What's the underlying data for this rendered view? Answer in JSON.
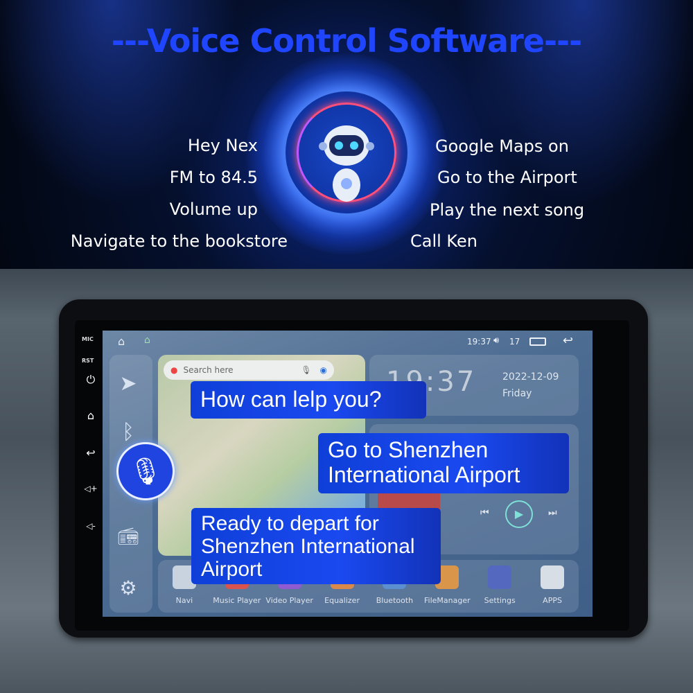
{
  "title": "---Voice Control Software---",
  "phrases_left": [
    "Hey Nex",
    "FM to 84.5",
    "Volume up",
    "Navigate to the bookstore"
  ],
  "phrases_right": [
    "Google Maps on",
    "Go to the Airport",
    "Play the next song",
    "Call Ken"
  ],
  "side_panel": {
    "mic": "MIC",
    "rst": "RST"
  },
  "status_bar": {
    "time": "19:37",
    "volume": "17"
  },
  "map": {
    "search_placeholder": "Search here"
  },
  "clock": {
    "time": "19:37",
    "date": "2022-12-09",
    "weekday": "Friday"
  },
  "bubbles": {
    "assistant_prompt": "How can lelp you?",
    "user_command": "Go to Shenzhen International Airport",
    "assistant_reply": "Ready to depart for Shenzhen International Airport"
  },
  "apps": [
    {
      "label": "Navi",
      "color": "#c9d3df"
    },
    {
      "label": "Music Player",
      "color": "#d9534f"
    },
    {
      "label": "Video Player",
      "color": "#8e5bd0"
    },
    {
      "label": "Equalizer",
      "color": "#d98a4a"
    },
    {
      "label": "Bluetooth",
      "color": "#5b8fd0"
    },
    {
      "label": "FileManager",
      "color": "#d9954a"
    },
    {
      "label": "Settings",
      "color": "#5568c0"
    },
    {
      "label": "APPS",
      "color": "#d8dee6"
    }
  ],
  "colors": {
    "title": "#1f45ff",
    "bubble": "#1a49f0"
  }
}
